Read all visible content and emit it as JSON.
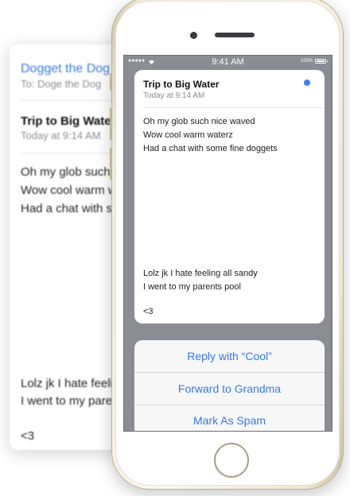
{
  "background_mail": {
    "from": "Dogget the Dog",
    "to": "To: Doge the Dog",
    "subject": "Trip to Big Water",
    "date": "Today at 9:14 AM",
    "body_lines": [
      "Oh my glob such nice waved",
      "Wow cool warm waterz",
      "Had a chat with some fine doggets"
    ],
    "footer_lines": [
      "Lolz jk I hate feeling all sandy",
      "I went to my parents pool"
    ],
    "signoff": "<3"
  },
  "status_bar": {
    "signal": "●●●●●",
    "time": "9:41 AM",
    "battery": "100%"
  },
  "mail": {
    "subject": "Trip to Big Water",
    "date": "Today at 9:14 AM",
    "body_lines": [
      "Oh my glob such nice waved",
      "Wow cool warm waterz",
      "Had a chat with some fine doggets"
    ],
    "footer_lines": [
      "Lolz jk I hate feeling all sandy",
      "I went to my parents pool"
    ],
    "signoff": "<3"
  },
  "actions": [
    {
      "label": "Reply with “Cool”"
    },
    {
      "label": "Forward to Grandma"
    },
    {
      "label": "Mark As Spam"
    }
  ],
  "colors": {
    "accent": "#3478f6",
    "unread_dot": "#3b82f0",
    "phone_frame": "#f3ecdc"
  }
}
